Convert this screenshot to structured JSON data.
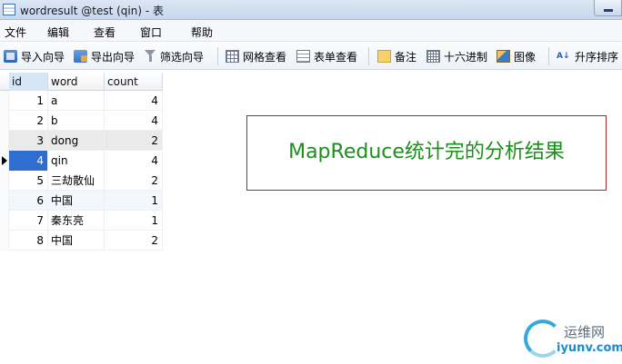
{
  "window": {
    "title": "wordresult @test (qin) - 表"
  },
  "menu": [
    "文件",
    "编辑",
    "查看",
    "窗口",
    "帮助"
  ],
  "toolbar": [
    {
      "label": "导入向导",
      "icon": "import-wizard-icon"
    },
    {
      "label": "导出向导",
      "icon": "export-wizard-icon"
    },
    {
      "label": "筛选向导",
      "icon": "filter-icon"
    },
    {
      "label": "网格查看",
      "icon": "grid-view-icon"
    },
    {
      "label": "表单查看",
      "icon": "form-view-icon"
    },
    {
      "label": "备注",
      "icon": "memo-icon"
    },
    {
      "label": "十六进制",
      "icon": "hex-icon"
    },
    {
      "label": "图像",
      "icon": "image-icon"
    },
    {
      "label": "升序排序",
      "icon": "sort-ascending-icon"
    }
  ],
  "grid": {
    "columns": [
      "id",
      "word",
      "count"
    ],
    "rows": [
      {
        "id": "1",
        "word": "a",
        "count": "4"
      },
      {
        "id": "2",
        "word": "b",
        "count": "4"
      },
      {
        "id": "3",
        "word": "dong",
        "count": "2"
      },
      {
        "id": "4",
        "word": "qin",
        "count": "4"
      },
      {
        "id": "5",
        "word": "三劫散仙",
        "count": "2"
      },
      {
        "id": "6",
        "word": "中国",
        "count": "1"
      },
      {
        "id": "7",
        "word": "秦东亮",
        "count": "1"
      },
      {
        "id": "8",
        "word": "中国",
        "count": "2"
      }
    ],
    "current_row": 4
  },
  "caption": "MapReduce统计完的分析结果",
  "watermark": {
    "name": "运维网",
    "url": "iyunv.com"
  },
  "colors": {
    "caption_text": "#1a8f1a",
    "caption_border": "#a22a2a",
    "selection": "#2f6dd1"
  }
}
